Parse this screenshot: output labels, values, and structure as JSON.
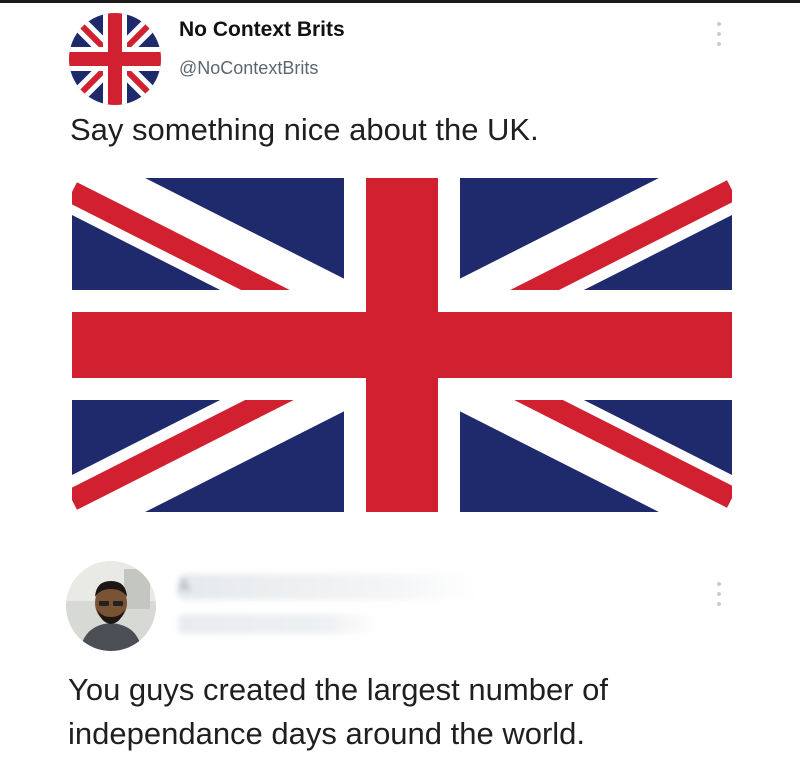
{
  "original_tweet": {
    "display_name": "No Context Brits",
    "handle": "@NoContextBrits",
    "text": "Say something nice about the UK.",
    "media": "union-jack-flag"
  },
  "reply_tweet": {
    "display_name_blurred": true,
    "handle_blurred": true,
    "text_lines": [
      "You guys created the largest number of",
      "independance days around the world."
    ]
  },
  "colors": {
    "flag_blue": "#1f2a6d",
    "flag_red": "#d1202f",
    "flag_white": "#ffffff"
  }
}
